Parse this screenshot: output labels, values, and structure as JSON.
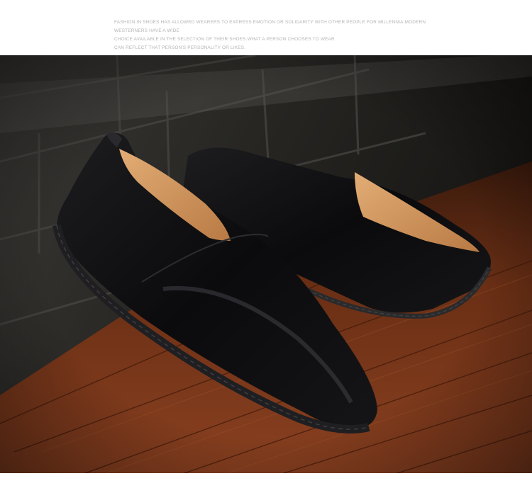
{
  "header": {
    "lines": [
      "FASHION IN SHOES HAS ALLOWED WEARERS TO EXPRESS EMOTION OR SOLIDARITY WITH OTHER PEOPLE FOR MILLENNIA.MODERN",
      "WESTERNERS HAVE A WIDE",
      "CHOICE AVAILABLE IN THE SELECTION OF THEIR SHOES.WHAT A PERSON CHOOSES TO WEAR",
      "CAN REFLECT THAT PERSON'S PERSONALITY OR LIKES."
    ]
  },
  "photo": {
    "subject": "two black leather slip-on loafers on a wooden floor beside a stone wall",
    "colors": {
      "leather": "#0d0d0f",
      "lining": "#d49a62",
      "wood": "#6e2f16",
      "stone": "#2d2c2a"
    }
  }
}
